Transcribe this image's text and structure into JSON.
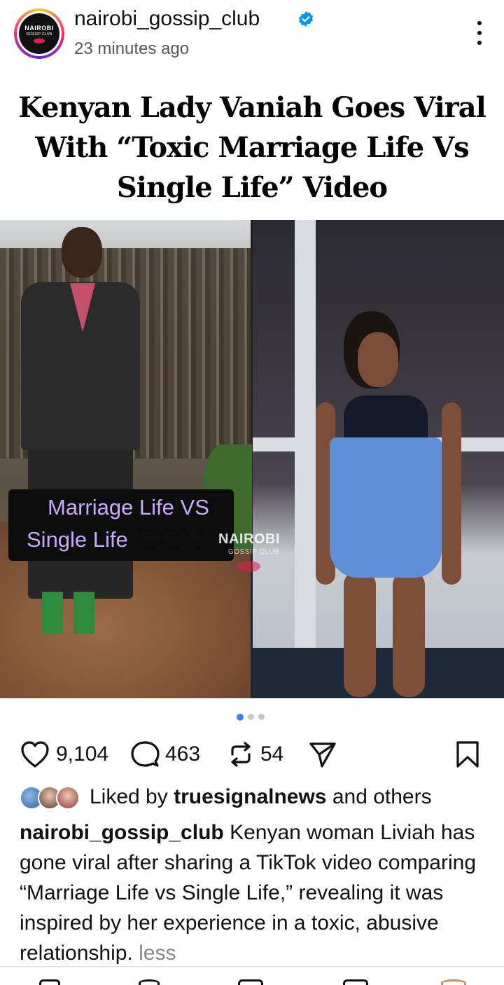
{
  "post": {
    "username": "nairobi_gossip_club",
    "verified": true,
    "time_ago": "23 minutes ago",
    "avatar_logo": {
      "line1": "NAIROBI",
      "line2": "GOSSIP CLUB"
    }
  },
  "headline": {
    "line1": "Kenyan Lady Vaniah Goes Viral",
    "line2": "With “Toxic Marriage Life Vs",
    "line3": "Single Life” Video"
  },
  "media": {
    "overlay_line1": "Marriage Life VS",
    "overlay_line2": "Single Life",
    "overlay_emoji": "😂😂😂",
    "watermark": "NAIROBI",
    "watermark_sub": "GOSSIP CLUB",
    "carousel": {
      "total": 3,
      "active_index": 0
    }
  },
  "actions": {
    "likes": "9,104",
    "comments": "463",
    "reposts": "54"
  },
  "liked_by": {
    "prefix": "Liked by",
    "user": "truesignalnews",
    "suffix": "and others"
  },
  "caption": {
    "author": "nairobi_gossip_club",
    "text": "Kenyan woman Liviah has gone viral after sharing a TikTok video comparing “Marriage Life vs Single Life,” revealing it was inspired by her experience in a toxic, abusive relationship.",
    "toggle": "less"
  },
  "icons": {
    "verified": "verified-badge-icon",
    "more": "more-vertical-icon",
    "like": "heart-icon",
    "comment": "comment-bubble-icon",
    "repost": "repost-icon",
    "share": "send-icon",
    "save": "bookmark-icon"
  },
  "colors": {
    "verified_blue": "#0095f6",
    "overlay_text": "#c9a8ff",
    "carousel_active": "#3b82f6",
    "muted_text": "#888888"
  }
}
